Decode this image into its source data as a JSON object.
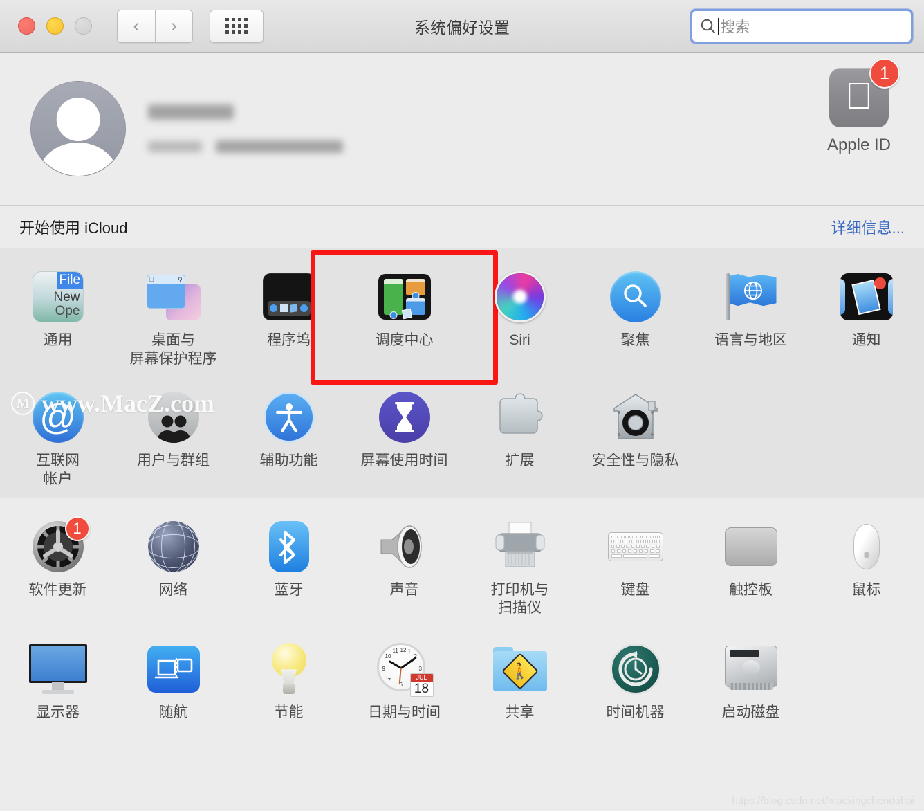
{
  "window": {
    "title": "系统偏好设置",
    "traffic_lights": [
      "close",
      "minimize",
      "zoom"
    ],
    "nav": {
      "back": "‹",
      "forward": "›",
      "grid_button": "show-all-grid"
    }
  },
  "search": {
    "placeholder": "搜索",
    "value": "",
    "icon": "search-icon",
    "focused": true
  },
  "account": {
    "avatar": "default-user-avatar",
    "name_redacted": true,
    "subtitle_redacted": true,
    "apple_id": {
      "label": "Apple ID",
      "icon": "apple-logo-icon",
      "badge": "1"
    }
  },
  "icloud_banner": {
    "title": "开始使用 iCloud",
    "link": "详细信息...",
    "link_color": "#3b69c4"
  },
  "highlight": {
    "target": "调度中心",
    "color": "#fb1616",
    "border_width": 7
  },
  "sections": [
    {
      "id": "personal",
      "rows": [
        [
          {
            "label": "通用",
            "icon": "general-icon"
          },
          {
            "label": "桌面与\n屏幕保护程序",
            "icon": "desktop-screensaver-icon"
          },
          {
            "label": "程序坞",
            "icon": "dock-icon"
          },
          {
            "label": "调度中心",
            "icon": "mission-control-icon",
            "highlighted": true
          },
          {
            "label": "Siri",
            "icon": "siri-icon"
          },
          {
            "label": "聚焦",
            "icon": "spotlight-icon"
          },
          {
            "label": "语言与地区",
            "icon": "language-region-icon"
          },
          {
            "label": "通知",
            "icon": "notifications-icon"
          }
        ],
        [
          {
            "label": "互联网\n帐户",
            "icon": "internet-accounts-icon"
          },
          {
            "label": "用户与群组",
            "icon": "users-groups-icon"
          },
          {
            "label": "辅助功能",
            "icon": "accessibility-icon"
          },
          {
            "label": "屏幕使用时间",
            "icon": "screen-time-icon"
          },
          {
            "label": "扩展",
            "icon": "extensions-icon"
          },
          {
            "label": "安全性与隐私",
            "icon": "security-privacy-icon"
          }
        ]
      ]
    },
    {
      "id": "hardware",
      "rows": [
        [
          {
            "label": "软件更新",
            "icon": "software-update-icon",
            "badge": "1"
          },
          {
            "label": "网络",
            "icon": "network-icon"
          },
          {
            "label": "蓝牙",
            "icon": "bluetooth-icon"
          },
          {
            "label": "声音",
            "icon": "sound-icon"
          },
          {
            "label": "打印机与\n扫描仪",
            "icon": "printers-scanners-icon"
          },
          {
            "label": "键盘",
            "icon": "keyboard-icon"
          },
          {
            "label": "触控板",
            "icon": "trackpad-icon"
          },
          {
            "label": "鼠标",
            "icon": "mouse-icon"
          }
        ],
        [
          {
            "label": "显示器",
            "icon": "displays-icon"
          },
          {
            "label": "随航",
            "icon": "sidecar-icon"
          },
          {
            "label": "节能",
            "icon": "energy-saver-icon"
          },
          {
            "label": "日期与时间",
            "icon": "date-time-icon",
            "cal_month": "JUL",
            "cal_day": "18"
          },
          {
            "label": "共享",
            "icon": "sharing-icon"
          },
          {
            "label": "时间机器",
            "icon": "time-machine-icon"
          },
          {
            "label": "启动磁盘",
            "icon": "startup-disk-icon"
          }
        ]
      ]
    }
  ],
  "watermarks": {
    "macz": "www.MacZ.com",
    "macz_mark": "M",
    "csdn": "https://blog.csdn.net/macxingchendahai"
  },
  "general_icon_text": {
    "file": "File",
    "new": "New",
    "open": "Ope"
  }
}
